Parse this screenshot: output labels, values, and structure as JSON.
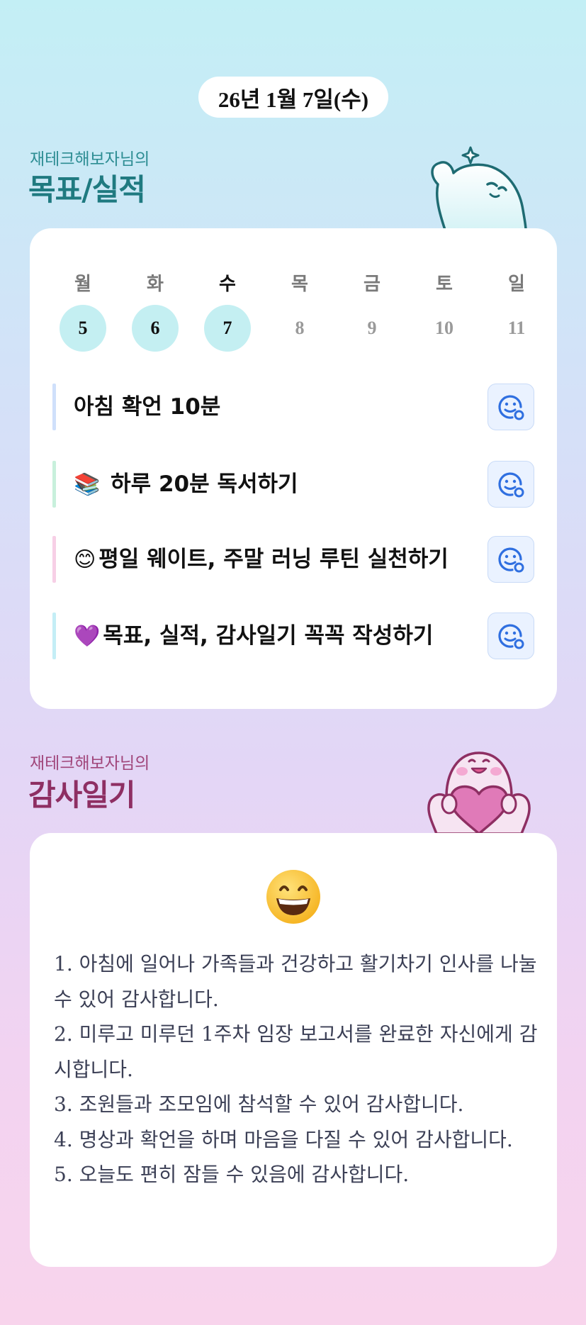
{
  "header": {
    "date": "26년 1월 7일(수)"
  },
  "goals_section": {
    "subtitle": "재테크해보자님의",
    "title": "목표/실적",
    "week": [
      {
        "day": "월",
        "num": "5",
        "done": true,
        "today": false
      },
      {
        "day": "화",
        "num": "6",
        "done": true,
        "today": false
      },
      {
        "day": "수",
        "num": "7",
        "done": true,
        "today": true
      },
      {
        "day": "목",
        "num": "8",
        "done": false,
        "today": false
      },
      {
        "day": "금",
        "num": "9",
        "done": false,
        "today": false
      },
      {
        "day": "토",
        "num": "10",
        "done": false,
        "today": false
      },
      {
        "day": "일",
        "num": "11",
        "done": false,
        "today": false
      }
    ],
    "goals": [
      {
        "emoji": "",
        "text": "아침 확언 10분",
        "accent": "#cfe0fb",
        "icon": "smile-add-icon"
      },
      {
        "emoji": "📚",
        "text": "하루 20분 독서하기",
        "accent": "#c8f0dc",
        "icon": "smile-add-icon"
      },
      {
        "emoji": "😊",
        "text": "평일 웨이트, 주말 러닝 루틴 실천하기",
        "accent": "#f7cfe6",
        "icon": "smile-add-icon"
      },
      {
        "emoji": "💜",
        "text": "목표, 실적, 감사일기 꼭꼭 작성하기",
        "accent": "#c4eef6",
        "icon": "smile-add-icon"
      }
    ]
  },
  "gratitude_section": {
    "subtitle": "재테크해보자님의",
    "title": "감사일기",
    "mood_icon": "grinning-face-icon",
    "entries": [
      "1. 아침에 일어나 가족들과 건강하고 활기차기 인사를 나눌 수 있어 감사합니다.",
      "2. 미루고 미루던 1주차 임장 보고서를 완료한 자신에게 감시합니다.",
      "3. 조원들과 조모임에 참석할 수 있어 감사합니다.",
      "4. 명상과 확언을 하며 마음을 다질 수 있어 감사합니다.",
      "5. 오늘도 편히 잠들 수 있음에 감사합니다."
    ]
  },
  "colors": {
    "done_day": "#c4eff2",
    "goals_title": "#1f7a80",
    "gratitude_title": "#8e2f63",
    "icon_blue": "#2f6fe0"
  }
}
